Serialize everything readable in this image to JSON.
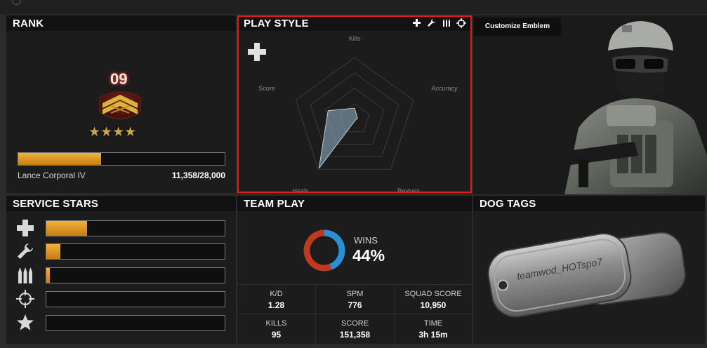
{
  "rank": {
    "title": "RANK",
    "number": "09",
    "name": "Lance Corporal IV",
    "score": "11,358",
    "max": "/28,000",
    "progress": 0.4
  },
  "play_style": {
    "title": "PLAY STYLE",
    "filter_icons": [
      "plus-icon",
      "wrench-icon",
      "ammo-icon",
      "crosshair-icon"
    ],
    "axes": [
      "Kills",
      "Accuracy",
      "Revives",
      "Heals",
      "Score"
    ],
    "values": [
      0.18,
      0.05,
      0.02,
      0.98,
      0.45
    ],
    "shown_icon": "plus-icon"
  },
  "soldier": {
    "customize_label": "Customize Emblem"
  },
  "service_stars": {
    "title": "SERVICE STARS",
    "classes": [
      {
        "icon": "plus-icon",
        "progress": 0.23
      },
      {
        "icon": "wrench-icon",
        "progress": 0.08
      },
      {
        "icon": "ammo-icon",
        "progress": 0.02
      },
      {
        "icon": "crosshair-icon",
        "progress": 0.0
      },
      {
        "icon": "star-icon",
        "progress": 0.0
      }
    ]
  },
  "team_play": {
    "title": "TEAM PLAY",
    "wins_label": "WINS",
    "wins_pct": "44%",
    "win_ratio": 0.44,
    "stats": [
      {
        "label": "K/D",
        "value": "1.28"
      },
      {
        "label": "SPM",
        "value": "776"
      },
      {
        "label": "SQUAD SCORE",
        "value": "10,950"
      },
      {
        "label": "KILLS",
        "value": "95"
      },
      {
        "label": "SCORE",
        "value": "151,358"
      },
      {
        "label": "TIME",
        "value": "3h 15m"
      }
    ]
  },
  "dog_tags": {
    "title": "DOG TAGS",
    "engraving": "teamwod_HOTspo7"
  },
  "colors": {
    "accent_orange": "#e09a24",
    "highlight_red": "#e11b1b",
    "wins_blue": "#2b8fd6",
    "losses_red": "#c0391f"
  }
}
